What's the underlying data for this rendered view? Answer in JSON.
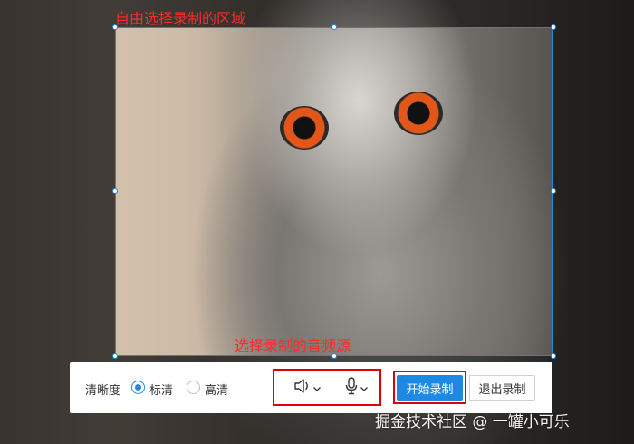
{
  "annotations": {
    "free_select_area": "自由选择录制的区域",
    "select_audio_source": "选择录制的音频源"
  },
  "toolbar": {
    "quality_label": "清晰度",
    "quality_options": [
      {
        "label": "标清",
        "checked": true
      },
      {
        "label": "高清",
        "checked": false
      }
    ],
    "speaker_icon": "speaker-icon",
    "mic_icon": "microphone-icon",
    "start_label": "开始录制",
    "exit_label": "退出录制"
  },
  "watermark": "掘金技术社区 @ 一罐小可乐",
  "colors": {
    "accent": "#1e88e5",
    "annotation_red": "#ff2a2a"
  }
}
